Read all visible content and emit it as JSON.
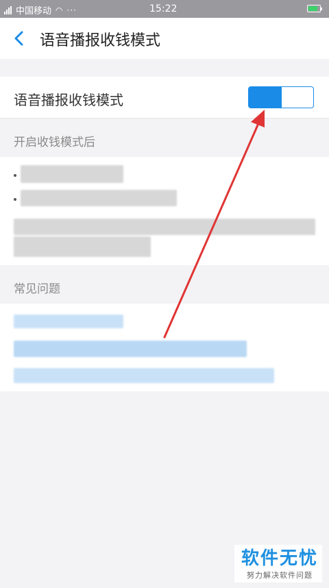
{
  "status_bar": {
    "carrier": "中国移动",
    "dots": "···",
    "time": "15:22"
  },
  "nav": {
    "title": "语音播报收钱模式"
  },
  "toggle_row": {
    "label": "语音播报收钱模式",
    "enabled": true
  },
  "sections": {
    "mode_info_header": "开启收钱模式后",
    "faq_header": "常见问题"
  },
  "watermark": {
    "title": "软件无忧",
    "subtitle": "努力解决软件问题"
  },
  "colors": {
    "accent": "#1a8ce8",
    "arrow": "#e03535",
    "status_bar_bg": "#9a999e",
    "page_bg": "#f3f3f5"
  }
}
